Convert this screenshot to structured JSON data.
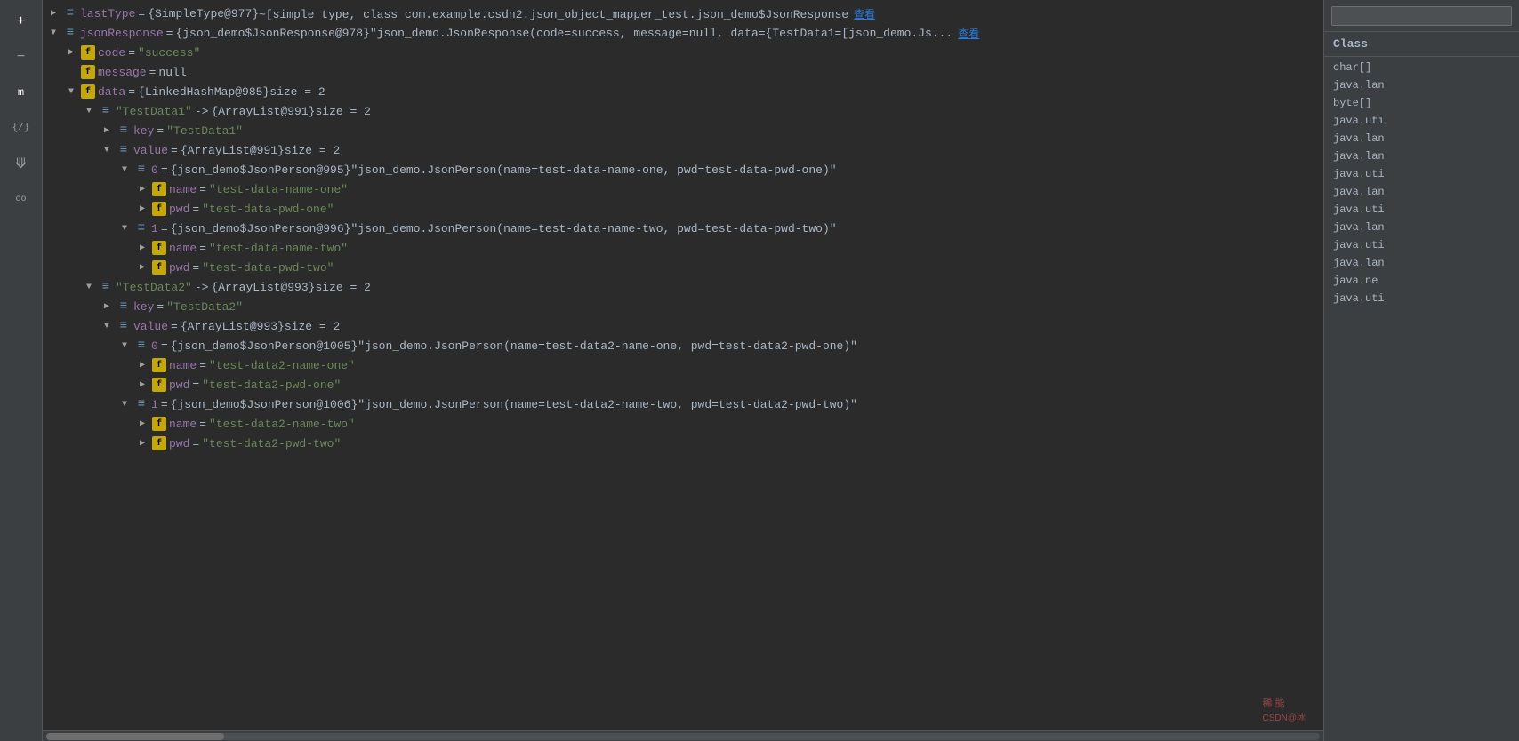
{
  "sidebar": {
    "icons": [
      {
        "name": "plus-icon",
        "symbol": "+",
        "active": true
      },
      {
        "name": "minus-icon",
        "symbol": "−",
        "active": false
      },
      {
        "name": "m-icon",
        "symbol": "m",
        "active": true
      },
      {
        "name": "left-brace-icon",
        "symbol": "{",
        "active": false
      },
      {
        "name": "step-over-icon",
        "symbol": "⤵",
        "active": false
      },
      {
        "name": "glasses-icon",
        "symbol": "oo",
        "active": false
      }
    ]
  },
  "right_panel": {
    "header": "Class",
    "search_placeholder": "",
    "items": [
      "char[]",
      "java.lan",
      "byte[]",
      "java.uti",
      "java.lan",
      "java.lan",
      "java.uti",
      "java.lan",
      "java.uti",
      "java.lan",
      "java.uti",
      "java.lan",
      "java.ne",
      "java.uti"
    ]
  },
  "tree": {
    "rows": [
      {
        "indent": 0,
        "toggle": "▶",
        "icon_type": "list",
        "var_name": "lastType",
        "equals": "=",
        "value_color": "default",
        "value": "{SimpleType@977}",
        "description": " ~[simple type, class com.example.csdn2.json_object_mapper_test.json_demo$JsonResponse<java.util.Map<ja...",
        "has_link": true,
        "link_text": "查看"
      },
      {
        "indent": 0,
        "toggle": "▼",
        "icon_type": "list",
        "var_name": "jsonResponse",
        "equals": "=",
        "value_color": "default",
        "value": "{json_demo$JsonResponse@978}",
        "description": " \"json_demo.JsonResponse(code=success, message=null, data={TestData1=[json_demo.Js...",
        "has_link": true,
        "link_text": "查看"
      },
      {
        "indent": 1,
        "toggle": "▶",
        "icon_type": "field",
        "var_name": "code",
        "equals": "=",
        "value_color": "green",
        "value": "\"success\"",
        "description": "",
        "has_link": false
      },
      {
        "indent": 1,
        "toggle": null,
        "icon_type": "field",
        "var_name": "message",
        "equals": "=",
        "value_color": "default",
        "value": "null",
        "description": "",
        "has_link": false
      },
      {
        "indent": 1,
        "toggle": "▼",
        "icon_type": "field",
        "var_name": "data",
        "equals": "=",
        "value_color": "default",
        "value": "{LinkedHashMap@985}",
        "description": "  size = 2",
        "has_link": false
      },
      {
        "indent": 2,
        "toggle": "▼",
        "icon_type": "list",
        "var_name": "\"TestData1\"",
        "equals": "->",
        "value_color": "default",
        "value": "{ArrayList@991}",
        "description": "  size = 2",
        "has_link": false,
        "name_color": "green"
      },
      {
        "indent": 3,
        "toggle": "▶",
        "icon_type": "list",
        "var_name": "key",
        "equals": "=",
        "value_color": "green",
        "value": "\"TestData1\"",
        "description": "",
        "has_link": false
      },
      {
        "indent": 3,
        "toggle": "▼",
        "icon_type": "list",
        "var_name": "value",
        "equals": "=",
        "value_color": "default",
        "value": "{ArrayList@991}",
        "description": "  size = 2",
        "has_link": false
      },
      {
        "indent": 4,
        "toggle": "▼",
        "icon_type": "list",
        "var_name": "0",
        "equals": "=",
        "value_color": "default",
        "value": "{json_demo$JsonPerson@995}",
        "description": " \"json_demo.JsonPerson(name=test-data-name-one, pwd=test-data-pwd-one)\"",
        "has_link": false
      },
      {
        "indent": 5,
        "toggle": "▶",
        "icon_type": "field",
        "var_name": "name",
        "equals": "=",
        "value_color": "green",
        "value": "\"test-data-name-one\"",
        "description": "",
        "has_link": false
      },
      {
        "indent": 5,
        "toggle": "▶",
        "icon_type": "field",
        "var_name": "pwd",
        "equals": "=",
        "value_color": "green",
        "value": "\"test-data-pwd-one\"",
        "description": "",
        "has_link": false
      },
      {
        "indent": 4,
        "toggle": "▼",
        "icon_type": "list",
        "var_name": "1",
        "equals": "=",
        "value_color": "default",
        "value": "{json_demo$JsonPerson@996}",
        "description": " \"json_demo.JsonPerson(name=test-data-name-two, pwd=test-data-pwd-two)\"",
        "has_link": false
      },
      {
        "indent": 5,
        "toggle": "▶",
        "icon_type": "field",
        "var_name": "name",
        "equals": "=",
        "value_color": "green",
        "value": "\"test-data-name-two\"",
        "description": "",
        "has_link": false
      },
      {
        "indent": 5,
        "toggle": "▶",
        "icon_type": "field",
        "var_name": "pwd",
        "equals": "=",
        "value_color": "green",
        "value": "\"test-data-pwd-two\"",
        "description": "",
        "has_link": false
      },
      {
        "indent": 2,
        "toggle": "▼",
        "icon_type": "list",
        "var_name": "\"TestData2\"",
        "equals": "->",
        "value_color": "default",
        "value": "{ArrayList@993}",
        "description": "  size = 2",
        "has_link": false,
        "name_color": "green"
      },
      {
        "indent": 3,
        "toggle": "▶",
        "icon_type": "list",
        "var_name": "key",
        "equals": "=",
        "value_color": "green",
        "value": "\"TestData2\"",
        "description": "",
        "has_link": false
      },
      {
        "indent": 3,
        "toggle": "▼",
        "icon_type": "list",
        "var_name": "value",
        "equals": "=",
        "value_color": "default",
        "value": "{ArrayList@993}",
        "description": "  size = 2",
        "has_link": false
      },
      {
        "indent": 4,
        "toggle": "▼",
        "icon_type": "list",
        "var_name": "0",
        "equals": "=",
        "value_color": "default",
        "value": "{json_demo$JsonPerson@1005}",
        "description": " \"json_demo.JsonPerson(name=test-data2-name-one, pwd=test-data2-pwd-one)\"",
        "has_link": false
      },
      {
        "indent": 5,
        "toggle": "▶",
        "icon_type": "field",
        "var_name": "name",
        "equals": "=",
        "value_color": "green",
        "value": "\"test-data2-name-one\"",
        "description": "",
        "has_link": false
      },
      {
        "indent": 5,
        "toggle": "▶",
        "icon_type": "field",
        "var_name": "pwd",
        "equals": "=",
        "value_color": "green",
        "value": "\"test-data2-pwd-one\"",
        "description": "",
        "has_link": false
      },
      {
        "indent": 4,
        "toggle": "▼",
        "icon_type": "list",
        "var_name": "1",
        "equals": "=",
        "value_color": "default",
        "value": "{json_demo$JsonPerson@1006}",
        "description": " \"json_demo.JsonPerson(name=test-data2-name-two, pwd=test-data2-pwd-two)\"",
        "has_link": false
      },
      {
        "indent": 5,
        "toggle": "▶",
        "icon_type": "field",
        "var_name": "name",
        "equals": "=",
        "value_color": "green",
        "value": "\"test-data2-name-two\"",
        "description": "",
        "has_link": false
      },
      {
        "indent": 5,
        "toggle": "▶",
        "icon_type": "field",
        "var_name": "pwd",
        "equals": "=",
        "value_color": "green",
        "value": "\"test-data2-pwd-two\"",
        "description": "",
        "has_link": false
      }
    ]
  },
  "watermark": "CSDN@冰"
}
